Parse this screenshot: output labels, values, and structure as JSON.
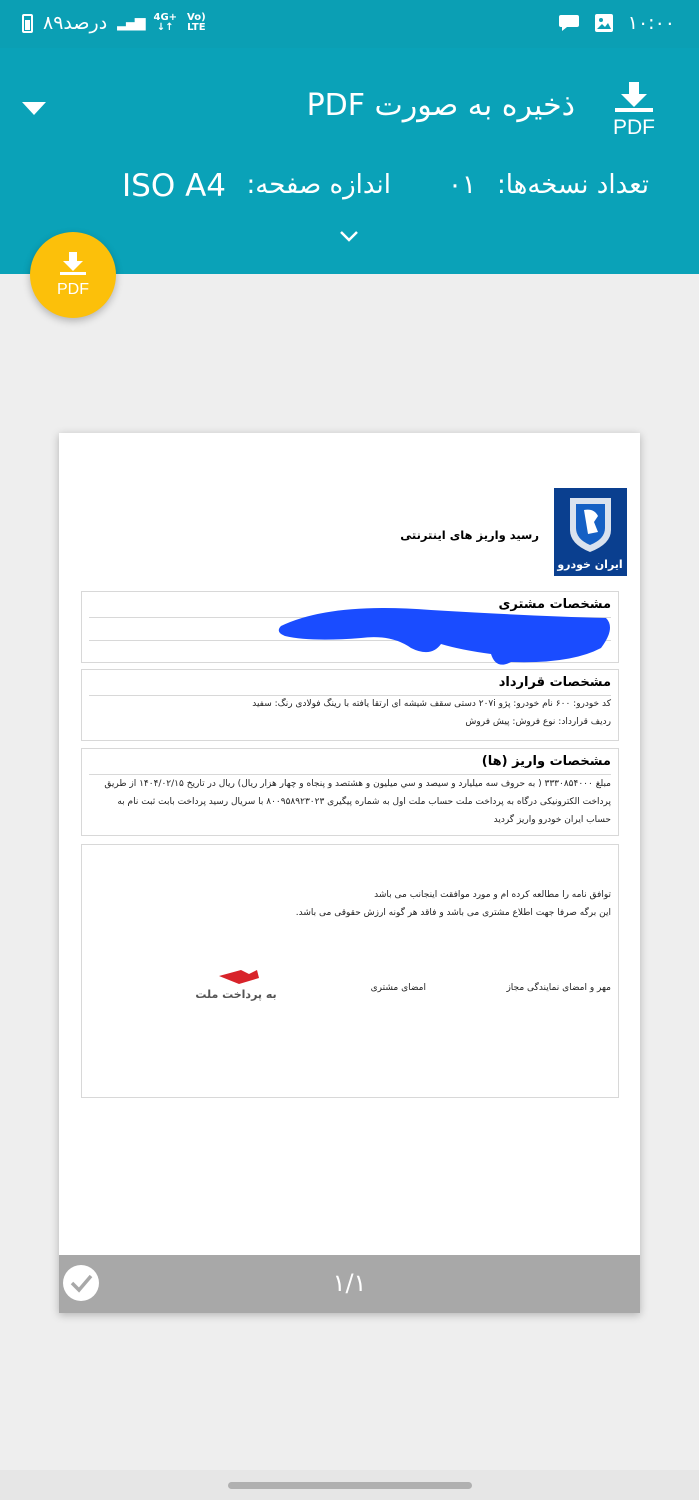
{
  "status_bar": {
    "time": "۱۰:۰۰",
    "battery": "۸۹درصد",
    "network_top": "4G+",
    "network_bottom": "LTE",
    "volte": "Vo)"
  },
  "header": {
    "title": "ذخیره به صورت PDF",
    "copies_label": "تعداد نسخه‌ها:",
    "copies_value": "۰۱",
    "paper_size_label": "اندازه صفحه:",
    "paper_size_value": "ISO A4",
    "save_icon_text": "PDF"
  },
  "fab": {
    "label": "PDF"
  },
  "document": {
    "receipt_title": "رسید واریز های اینترنتی",
    "logo_text": "ایران خودرو",
    "customer_section_title": "مشخصات مشتری",
    "contract_section_title": "مشخصات قرارداد",
    "contract_line1": "کد خودرو:  ۶۰۰   نام خودرو:  پژو ۲۰۷i دستی سقف شیشه ای ارتقا یافته با رینگ فولادی  رنگ:  سفید",
    "contract_line2": "ردیف قرارداد:   نوع فروش:  پیش فروش",
    "payment_section_title": "مشخصات واریز (ها)",
    "payment_line1": "مبلغ ۳۳۳۰۸۵۴۰۰۰ ( به حروف سه میلیارد و سیصد و سي میلیون و هشتصد و پنجاه و چهار هزار ریال) ریال در تاریخ ۱۴۰۴/۰۲/۱۵ از طریق",
    "payment_line2": "پرداخت الکترونیکی درگاه به پرداخت ملت حساب ملت اول به شماره پیگیری ۸۰۰۹۵۸۹۲۳۰۲۳ با سریال رسید پرداخت بابت ثبت نام به",
    "payment_line3": "حساب ایران خودرو واریز گردید",
    "agreement_line1": "توافق نامه را مطالعه کرده ام و مورد موافقت اینجانب می باشد",
    "agreement_line2": "این برگه صرفا جهت اطلاع مشتری می باشد و فاقد هر گونه ارزش حقوقی می باشد.",
    "sign_agent": "مهر و امضای نمایندگی مجاز",
    "sign_customer": "امضای مشتری",
    "mellat_logo_text": "به پرداخت ملت",
    "page_indicator": "۱/۱"
  },
  "colors": {
    "header": "#0aa2b8",
    "fab": "#fcc00a",
    "redaction": "#1a4cff"
  }
}
